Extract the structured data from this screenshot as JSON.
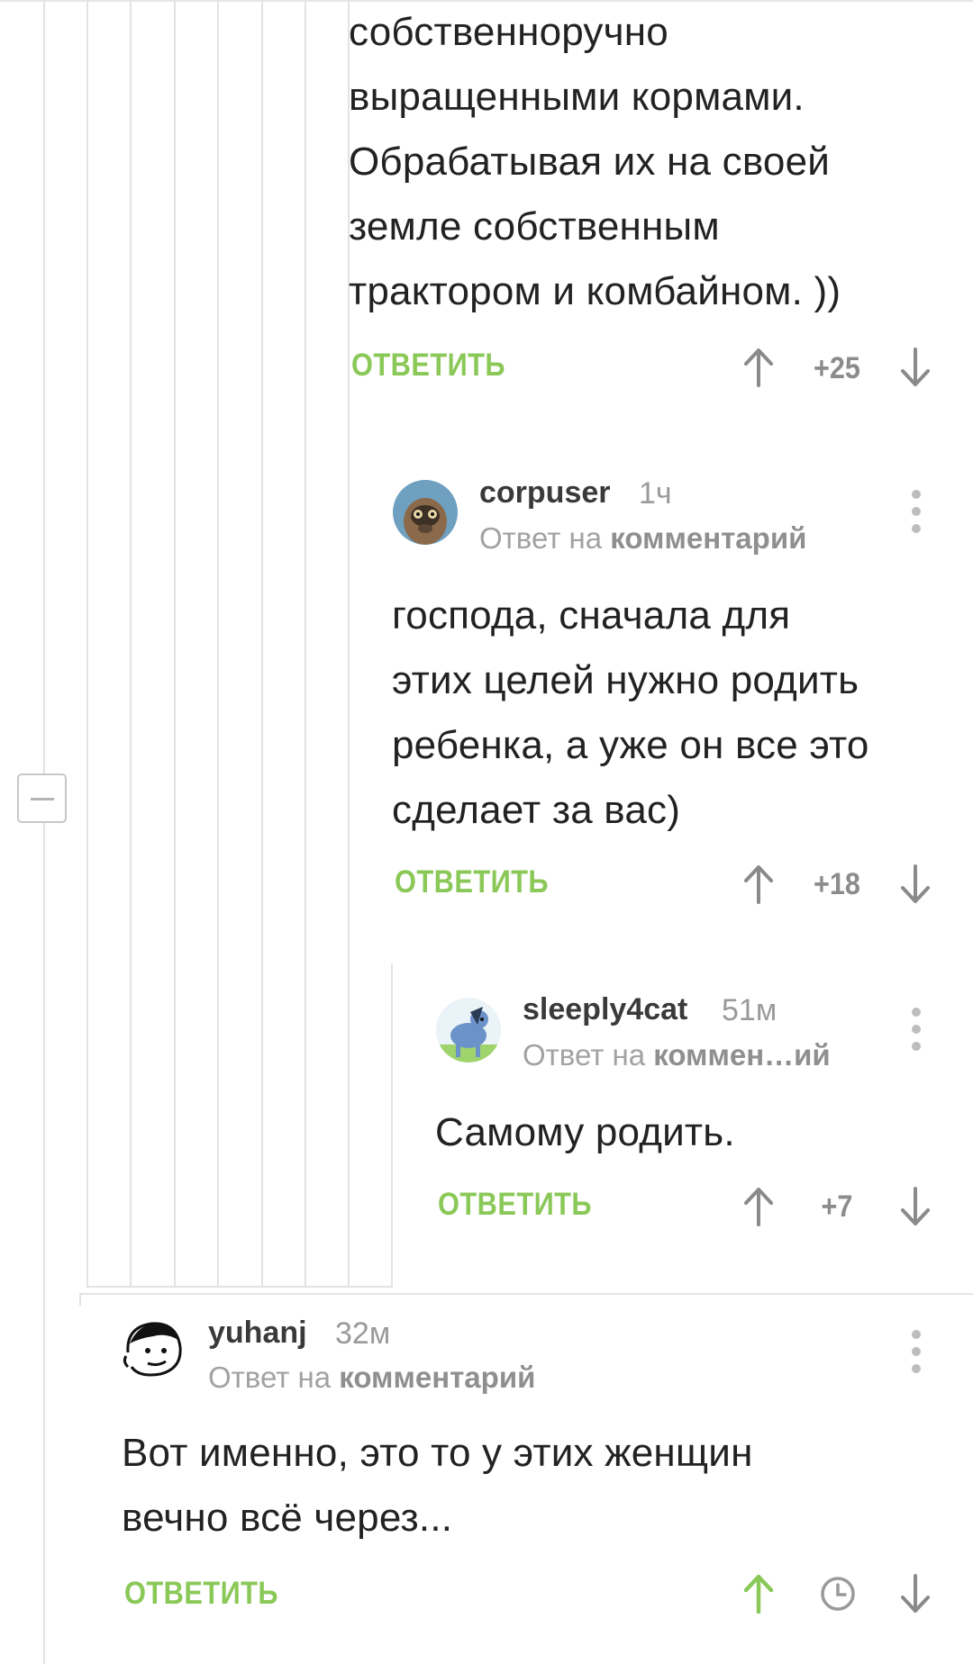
{
  "comments": [
    {
      "lines": [
        "собственноручно",
        "выращенными кормами.",
        "Обрабатывая их на своей",
        "земле собственным",
        "трактором и комбайном. ))"
      ],
      "reply_label": "ОТВЕТИТЬ",
      "score": "+25"
    },
    {
      "username": "corpuser",
      "time": "1ч",
      "reply_to_prefix": "Ответ на",
      "reply_to_link": "комментарий",
      "lines": [
        "господа, сначала для",
        "этих целей нужно родить",
        "ребенка, а уже он все это",
        "сделает за вас)"
      ],
      "reply_label": "ОТВЕТИТЬ",
      "score": "+18",
      "avatar_icon": "raccoon-avatar"
    },
    {
      "username": "sleeply4cat",
      "time": "51м",
      "reply_to_prefix": "Ответ на",
      "reply_to_link": "коммен…ий",
      "lines": [
        "Самому родить."
      ],
      "reply_label": "ОТВЕТИТЬ",
      "score": "+7",
      "avatar_icon": "pony-avatar"
    },
    {
      "username": "yuhanj",
      "time": "32м",
      "reply_to_prefix": "Ответ на",
      "reply_to_link": "комментарий",
      "lines": [
        "Вот именно, это то у этих женщин",
        "вечно всё через..."
      ],
      "reply_label": "ОТВЕТИТЬ",
      "avatar_icon": "meme-face-avatar",
      "vote_state": "upvoted-pending"
    }
  ],
  "colors": {
    "reply_green": "#8ac858",
    "upvote_active": "#8ac858",
    "icon_gray": "#9a9a9a",
    "thread_line": "#e3e3e3"
  }
}
